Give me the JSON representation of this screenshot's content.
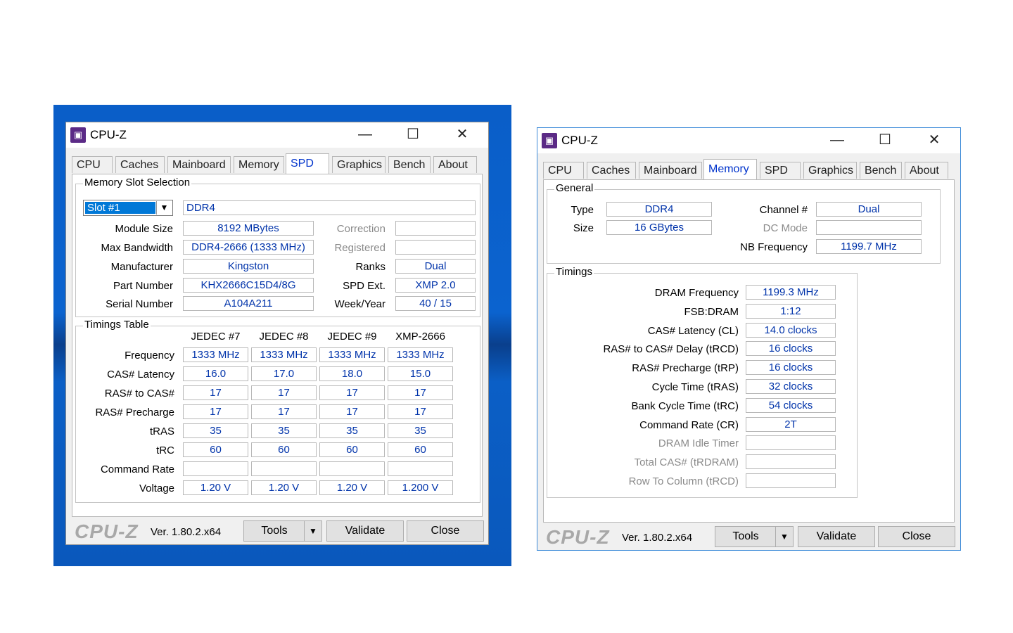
{
  "app": {
    "title": "CPU-Z",
    "logo": "CPU-Z",
    "version": "Ver. 1.80.2.x64"
  },
  "tabs": [
    "CPU",
    "Caches",
    "Mainboard",
    "Memory",
    "SPD",
    "Graphics",
    "Bench",
    "About"
  ],
  "buttons": {
    "tools": "Tools",
    "validate": "Validate",
    "close": "Close"
  },
  "spd": {
    "slot_group_label": "Memory Slot Selection",
    "slot_selected": "Slot #1",
    "mem_type": "DDR4",
    "labels": {
      "module_size": "Module Size",
      "max_bandwidth": "Max Bandwidth",
      "manufacturer": "Manufacturer",
      "part_number": "Part Number",
      "serial_number": "Serial Number",
      "correction": "Correction",
      "registered": "Registered",
      "ranks": "Ranks",
      "spd_ext": "SPD Ext.",
      "week_year": "Week/Year"
    },
    "values": {
      "module_size": "8192 MBytes",
      "max_bandwidth": "DDR4-2666 (1333 MHz)",
      "manufacturer": "Kingston",
      "part_number": "KHX2666C15D4/8G",
      "serial_number": "A104A211",
      "ranks": "Dual",
      "spd_ext": "XMP 2.0",
      "week_year": "40 / 15"
    },
    "timings_group_label": "Timings Table",
    "columns": [
      "JEDEC #7",
      "JEDEC #8",
      "JEDEC #9",
      "XMP-2666"
    ],
    "row_labels": [
      "Frequency",
      "CAS# Latency",
      "RAS# to CAS#",
      "RAS# Precharge",
      "tRAS",
      "tRC",
      "Command Rate",
      "Voltage"
    ],
    "rows": [
      [
        "1333 MHz",
        "1333 MHz",
        "1333 MHz",
        "1333 MHz"
      ],
      [
        "16.0",
        "17.0",
        "18.0",
        "15.0"
      ],
      [
        "17",
        "17",
        "17",
        "17"
      ],
      [
        "17",
        "17",
        "17",
        "17"
      ],
      [
        "35",
        "35",
        "35",
        "35"
      ],
      [
        "60",
        "60",
        "60",
        "60"
      ],
      [
        "",
        "",
        "",
        ""
      ],
      [
        "1.20 V",
        "1.20 V",
        "1.20 V",
        "1.200 V"
      ]
    ]
  },
  "memory": {
    "general_label": "General",
    "labels": {
      "type": "Type",
      "size": "Size",
      "channel": "Channel #",
      "dc_mode": "DC Mode",
      "nb_freq": "NB Frequency"
    },
    "values": {
      "type": "DDR4",
      "size": "16 GBytes",
      "channel": "Dual",
      "dc_mode": "",
      "nb_freq": "1199.7 MHz"
    },
    "timings_label": "Timings",
    "timing_labels": [
      "DRAM Frequency",
      "FSB:DRAM",
      "CAS# Latency (CL)",
      "RAS# to CAS# Delay (tRCD)",
      "RAS# Precharge (tRP)",
      "Cycle Time (tRAS)",
      "Bank Cycle Time (tRC)",
      "Command Rate (CR)",
      "DRAM Idle Timer",
      "Total CAS# (tRDRAM)",
      "Row To Column (tRCD)"
    ],
    "timing_values": [
      "1199.3 MHz",
      "1:12",
      "14.0 clocks",
      "16 clocks",
      "16 clocks",
      "32 clocks",
      "54 clocks",
      "2T",
      "",
      "",
      ""
    ]
  }
}
